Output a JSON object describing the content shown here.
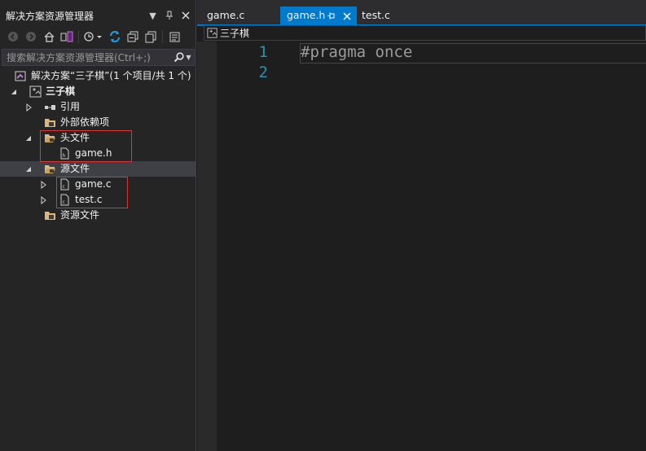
{
  "explorer": {
    "title": "解决方案资源管理器",
    "search_placeholder": "搜索解决方案资源管理器(Ctrl+;)",
    "solution_label": "解决方案“三子棋”(1 个项目/共 1 个)",
    "project_label": "三子棋",
    "references_label": "引用",
    "external_deps_label": "外部依赖项",
    "header_files_label": "头文件",
    "header_files": [
      "game.h"
    ],
    "source_files_label": "源文件",
    "source_files": [
      "game.c",
      "test.c"
    ],
    "resource_files_label": "资源文件"
  },
  "tabs": [
    {
      "label": "game.c",
      "active": false
    },
    {
      "label": "game.h",
      "active": true
    },
    {
      "label": "test.c",
      "active": false
    }
  ],
  "navbar": {
    "project": "三子棋"
  },
  "editor": {
    "lines": [
      {
        "number": "1",
        "text": "#pragma once"
      },
      {
        "number": "2",
        "text": ""
      }
    ]
  },
  "colors": {
    "accent": "#007acc",
    "line_number": "#2b91af",
    "highlight_box": "#e03434"
  }
}
